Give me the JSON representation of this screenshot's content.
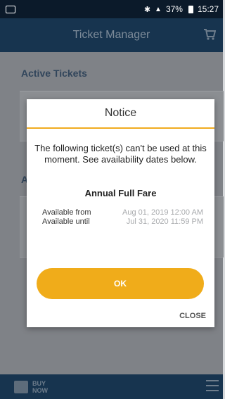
{
  "status_bar": {
    "battery": "37%",
    "time": "15:27"
  },
  "header": {
    "title": "Ticket Manager"
  },
  "sections": {
    "active_tickets": "Active Tickets",
    "second_section_initial": "A"
  },
  "modal": {
    "title": "Notice",
    "message": "The following ticket(s) can't be used at this moment. See availability dates below.",
    "ticket_name": "Annual Full Fare",
    "available_from_label": "Available from",
    "available_from_value": "Aug 01, 2019 12:00 AM",
    "available_until_label": "Available until",
    "available_until_value": "Jul 31, 2020 11:59 PM",
    "ok_label": "OK",
    "close_label": "CLOSE"
  },
  "bottom_bar": {
    "buy_line1": "BUY",
    "buy_line2": "NOW"
  },
  "colors": {
    "accent": "#f0ac1a",
    "header_bg": "#17344f"
  }
}
